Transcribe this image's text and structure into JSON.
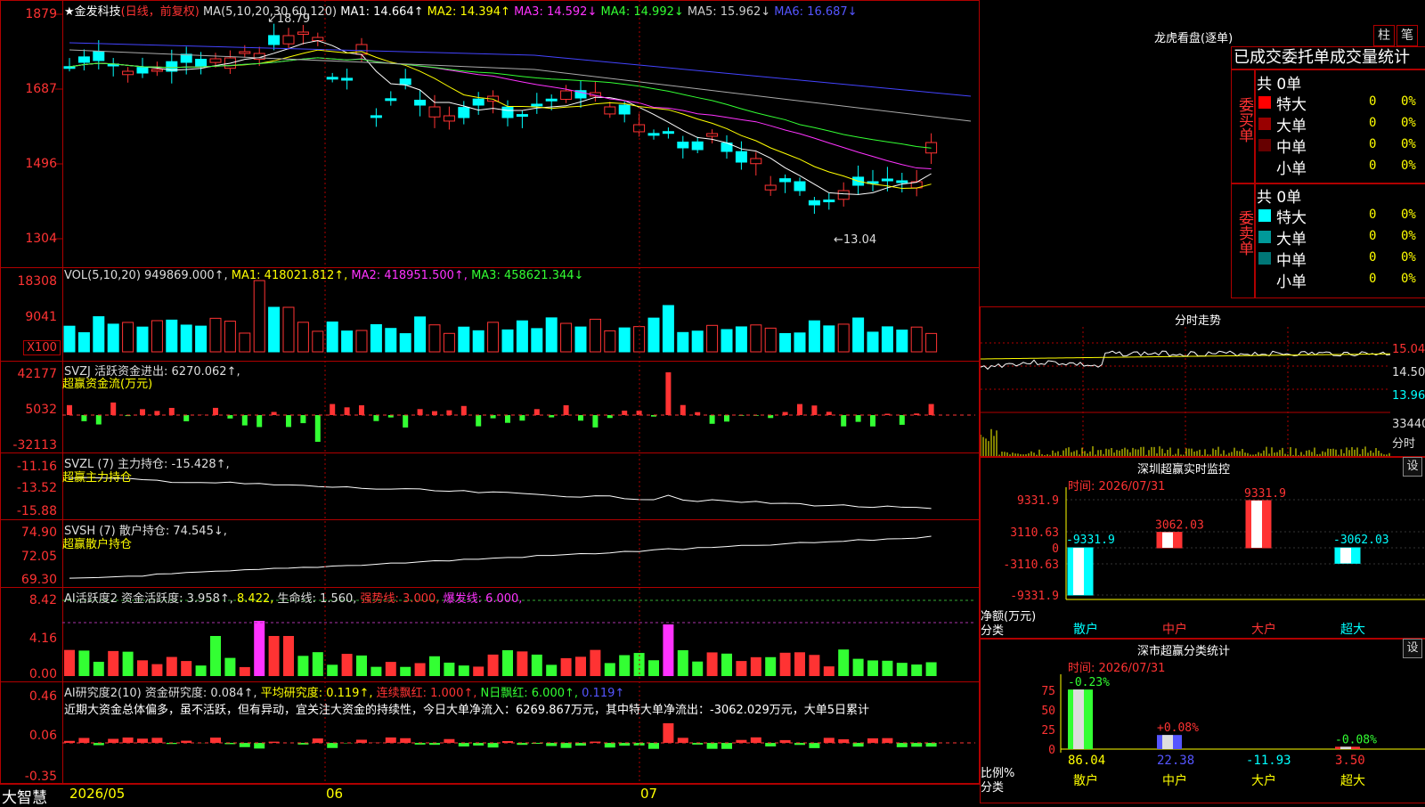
{
  "main": {
    "stock_name": "★金发科技",
    "period": "(日线，前复权)",
    "ma_line": [
      {
        "label": "MA(5,10,20,30,60,120)",
        "color": "#dddddd"
      },
      {
        "label": "MA1: 14.664↑",
        "color": "#ffffff"
      },
      {
        "label": "MA2: 14.394↑",
        "color": "#ffff00"
      },
      {
        "label": "MA3: 14.592↓",
        "color": "#ff33ff"
      },
      {
        "label": "MA4: 14.992↓",
        "color": "#33ff33"
      },
      {
        "label": "MA5: 15.962↓",
        "color": "#cccccc"
      },
      {
        "label": "MA6: 16.687↓",
        "color": "#5555ff"
      }
    ],
    "yaxis": [
      "1879",
      "1687",
      "1496",
      "1304"
    ],
    "high_label": "18.79",
    "low_label": "13.04"
  },
  "volume": {
    "title": "VOL(5,10,20) 949869.000↑,",
    "ma1": "MA1: 418021.812↑,",
    "ma2": "MA2: 418951.500↑,",
    "ma3": "MA3: 458621.344↓",
    "yaxis": [
      "18308",
      "9041"
    ],
    "unit": "X100"
  },
  "svzj": {
    "title": "SVZJ  活跃资金进出: 6270.062↑,",
    "sub": "超赢资金流(万元)",
    "yaxis": [
      "42177",
      "5032",
      "-32113"
    ]
  },
  "svzl": {
    "title": "SVZL (7) 主力持仓: -15.428↑,",
    "sub": "超赢主力持仓",
    "yaxis": [
      "-11.16",
      "-13.52",
      "-15.88"
    ]
  },
  "svsh": {
    "title": "SVSH (7) 散户持仓: 74.545↓,",
    "sub": "超赢散户持仓",
    "yaxis": [
      "74.90",
      "72.05",
      "69.30"
    ]
  },
  "ai_active": {
    "title": "AI活跃度2 资金活跃度: 3.958↑,",
    "v2": "8.422,",
    "life": "生命线: 1.560,",
    "strong": "强势线: 3.000,",
    "burst": "爆发线: 6.000,",
    "yaxis": [
      "8.42",
      "4.16",
      "0.00"
    ]
  },
  "ai_research": {
    "title": "AI研究度2(10) 资金研究度: 0.084↑,",
    "avg": "平均研究度: 0.119↑,",
    "cont": "连续飘红: 1.000↑,",
    "nday": "N日飘红: 6.000↑,",
    "last": "0.119↑",
    "comment": "近期大资金总体偏多，虽不活跃，但有异动，宜关注大资金的持续性，今日大单净流入：6269.867万元，其中特大单净流出：-3062.029万元，大单5日累计",
    "yaxis": [
      "0.46",
      "0.06",
      "-0.35"
    ]
  },
  "xaxis": [
    "2026/05",
    "06",
    "07"
  ],
  "brand": "大智慧",
  "right": {
    "lhb_title": "龙虎看盘(逐单)",
    "tab_bar": "柱",
    "tab_pen": "笔",
    "tabs": "已成交委托单成交量统计",
    "buy_label": "委买单",
    "sell_label": "委卖单",
    "buy_total": "共 0单",
    "sell_total": "共 0单",
    "buy_rows": [
      {
        "name": "特大",
        "count": "0",
        "pct": "0%",
        "color": "#ff0000"
      },
      {
        "name": "大单",
        "count": "0",
        "pct": "0%",
        "color": "#990000"
      },
      {
        "name": "中单",
        "count": "0",
        "pct": "0%",
        "color": "#660000"
      },
      {
        "name": "小单",
        "count": "0",
        "pct": "0%",
        "color": "#000000"
      }
    ],
    "sell_rows": [
      {
        "name": "特大",
        "count": "0",
        "pct": "0%",
        "color": "#00ffff"
      },
      {
        "name": "大单",
        "count": "0",
        "pct": "0%",
        "color": "#009999"
      },
      {
        "name": "中单",
        "count": "0",
        "pct": "0%",
        "color": "#007777"
      },
      {
        "name": "小单",
        "count": "0",
        "pct": "0%",
        "color": "#000000"
      }
    ],
    "fenshi_title": "分时走势",
    "fenshi_y": [
      "15.04",
      "14.50",
      "13.96"
    ],
    "fenshi_vol": "33440",
    "fenshi_unit": "分时",
    "monitor_title": "深圳超赢实时监控",
    "monitor_time": "时间: 2026/07/31",
    "monitor_set": "设",
    "monitor_y": [
      "9331.9",
      "3110.63",
      "0",
      "-3110.63",
      "-9331.9"
    ],
    "monitor_ylabel": "净额(万元)",
    "monitor_xlabel": "分类",
    "monitor_vals": [
      {
        "cat": "散户",
        "label": "-9331.9",
        "color": "#00ffff"
      },
      {
        "cat": "中户",
        "label": "3062.03",
        "color": "#ff3333"
      },
      {
        "cat": "大户",
        "label": "9331.9",
        "color": "#ff3333"
      },
      {
        "cat": "超大",
        "label": "-3062.03",
        "color": "#00ffff"
      }
    ],
    "stat_title": "深市超赢分类统计",
    "stat_time": "时间: 2026/07/31",
    "stat_set": "设",
    "stat_y": [
      "75",
      "50",
      "25",
      "0"
    ],
    "stat_ylabel": "比例%",
    "stat_xlabel": "分类",
    "stat_top": [
      {
        "label": "-0.23%",
        "color": "#33ff33"
      },
      {
        "label": "+0.08%",
        "color": "#ff3333"
      },
      {
        "label": "",
        "color": "#33ff33"
      },
      {
        "label": "-0.08%",
        "color": "#33ff33"
      }
    ],
    "stat_bottom": [
      {
        "cat": "散户",
        "val": "86.04",
        "color": "#ffff00"
      },
      {
        "cat": "中户",
        "val": "22.38",
        "color": "#5555ff"
      },
      {
        "cat": "大户",
        "val": "-11.93",
        "color": "#00ffff"
      },
      {
        "cat": "超大",
        "val": "3.50",
        "color": "#ff3333"
      }
    ]
  }
}
